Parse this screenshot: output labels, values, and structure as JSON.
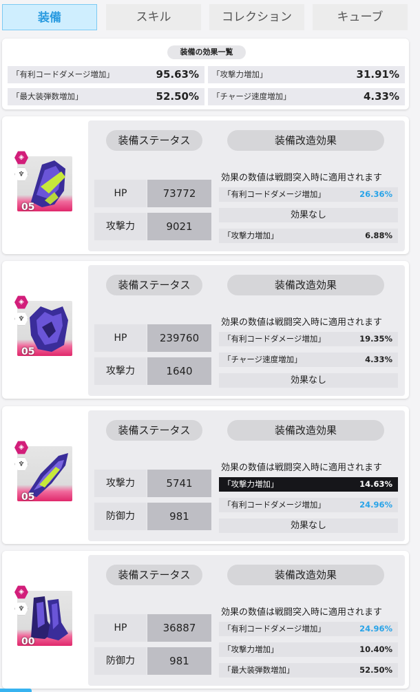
{
  "tabs": [
    {
      "label": "装備",
      "active": true
    },
    {
      "label": "スキル",
      "active": false
    },
    {
      "label": "コレクション",
      "active": false
    },
    {
      "label": "キューブ",
      "active": false
    }
  ],
  "summary": {
    "title": "装備の効果一覧",
    "rows": [
      {
        "label": "「有利コードダメージ増加」",
        "value": "95.63%"
      },
      {
        "label": "「攻撃力増加」",
        "value": "31.91%"
      },
      {
        "label": "「最大装弾数増加」",
        "value": "52.50%"
      },
      {
        "label": "「チャージ速度増加」",
        "value": "4.33%"
      }
    ]
  },
  "colors": {
    "accent": "#27a3e8",
    "pink": "#e0286b",
    "tab_active_bg": "#cfeefe"
  },
  "equipment": [
    {
      "icon": "helmet-icon",
      "level": "05",
      "status_title": "装備ステータス",
      "mod_title": "装備改造効果",
      "note": "効果の数値は戦闘突入時に適用されます",
      "stats": [
        {
          "label": "HP",
          "value": "73772"
        },
        {
          "label": "攻撃力",
          "value": "9021"
        }
      ],
      "effects": [
        {
          "label": "「有利コードダメージ増加」",
          "value": "26.36%",
          "style": "blue"
        },
        {
          "label": "効果なし",
          "value": "",
          "style": "none"
        },
        {
          "label": "「攻撃力増加」",
          "value": "6.88%",
          "style": "normal"
        }
      ]
    },
    {
      "icon": "chest-armor-icon",
      "level": "05",
      "status_title": "装備ステータス",
      "mod_title": "装備改造効果",
      "note": "効果の数値は戦闘突入時に適用されます",
      "stats": [
        {
          "label": "HP",
          "value": "239760"
        },
        {
          "label": "攻撃力",
          "value": "1640"
        }
      ],
      "effects": [
        {
          "label": "「有利コードダメージ増加」",
          "value": "19.35%",
          "style": "normal"
        },
        {
          "label": "「チャージ速度増加」",
          "value": "4.33%",
          "style": "normal"
        },
        {
          "label": "効果なし",
          "value": "",
          "style": "none"
        }
      ]
    },
    {
      "icon": "gauntlet-icon",
      "level": "05",
      "status_title": "装備ステータス",
      "mod_title": "装備改造効果",
      "note": "効果の数値は戦闘突入時に適用されます",
      "stats": [
        {
          "label": "攻撃力",
          "value": "5741"
        },
        {
          "label": "防御力",
          "value": "981"
        }
      ],
      "effects": [
        {
          "label": "「攻撃力増加」",
          "value": "14.63%",
          "style": "dark"
        },
        {
          "label": "「有利コードダメージ増加」",
          "value": "24.96%",
          "style": "blue"
        },
        {
          "label": "効果なし",
          "value": "",
          "style": "none"
        }
      ]
    },
    {
      "icon": "boots-icon",
      "level": "00",
      "status_title": "装備ステータス",
      "mod_title": "装備改造効果",
      "note": "効果の数値は戦闘突入時に適用されます",
      "stats": [
        {
          "label": "HP",
          "value": "36887"
        },
        {
          "label": "防御力",
          "value": "981"
        }
      ],
      "effects": [
        {
          "label": "「有利コードダメージ増加」",
          "value": "24.96%",
          "style": "blue"
        },
        {
          "label": "「攻撃力増加」",
          "value": "10.40%",
          "style": "normal"
        },
        {
          "label": "「最大装弾数増加」",
          "value": "52.50%",
          "style": "normal"
        }
      ]
    }
  ]
}
